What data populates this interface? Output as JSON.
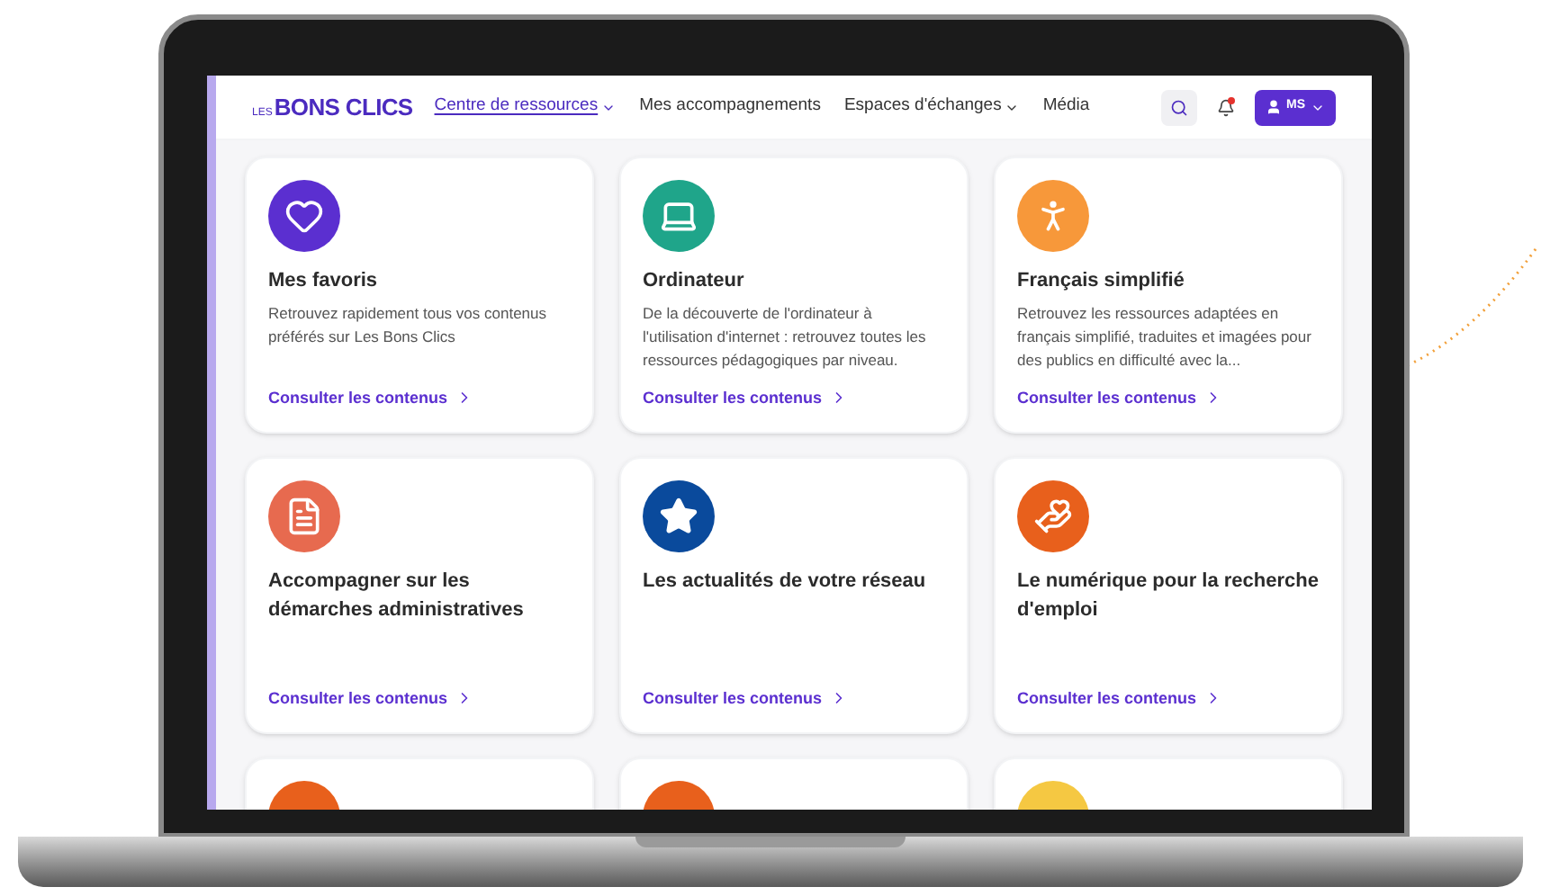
{
  "logo": {
    "small": "LES",
    "big": "BONS CLICS"
  },
  "nav": [
    {
      "label": "Centre de ressources",
      "dropdown": true,
      "selected": true
    },
    {
      "label": "Mes accompagnements",
      "dropdown": false,
      "selected": false
    },
    {
      "label": "Espaces d'échanges",
      "dropdown": true,
      "selected": false
    },
    {
      "label": "Média",
      "dropdown": false,
      "selected": false
    }
  ],
  "notifications": {
    "unread": true
  },
  "user": {
    "initials": "MS"
  },
  "cards": [
    {
      "kind": "heart",
      "color": "#5b2fd0",
      "title": "Mes favoris",
      "description": "Retrouvez rapidement tous vos contenus préférés sur Les Bons Clics",
      "link": "Consulter les contenus"
    },
    {
      "kind": "laptop",
      "color": "#1fa58a",
      "title": "Ordinateur",
      "description": "De la découverte de l'ordinateur à l'utilisation d'internet : retrouvez toutes les ressources pédagogiques par niveau.",
      "link": "Consulter les contenus"
    },
    {
      "kind": "accessibility",
      "color": "#f7983a",
      "title": "Français simplifié",
      "description": "Retrouvez les ressources adaptées en français simplifié, traduites et imagées pour des publics en difficulté avec la...",
      "link": "Consulter les contenus"
    },
    {
      "kind": "document",
      "color": "#e76a4f",
      "title": "Accompagner sur les démarches administratives",
      "link": "Consulter les contenus"
    },
    {
      "kind": "star",
      "color": "#0a4a9c",
      "title": "Les actualités de votre réseau",
      "link": "Consulter les contenus"
    },
    {
      "kind": "people",
      "color": "#e8601c",
      "title": "Le numérique pour la recherche d'emploi",
      "link": "Consulter les contenus"
    },
    {
      "kind": "plain",
      "color": "#e8601c"
    },
    {
      "kind": "plain",
      "color": "#e8601c"
    },
    {
      "kind": "plain",
      "color": "#f5c842"
    }
  ]
}
